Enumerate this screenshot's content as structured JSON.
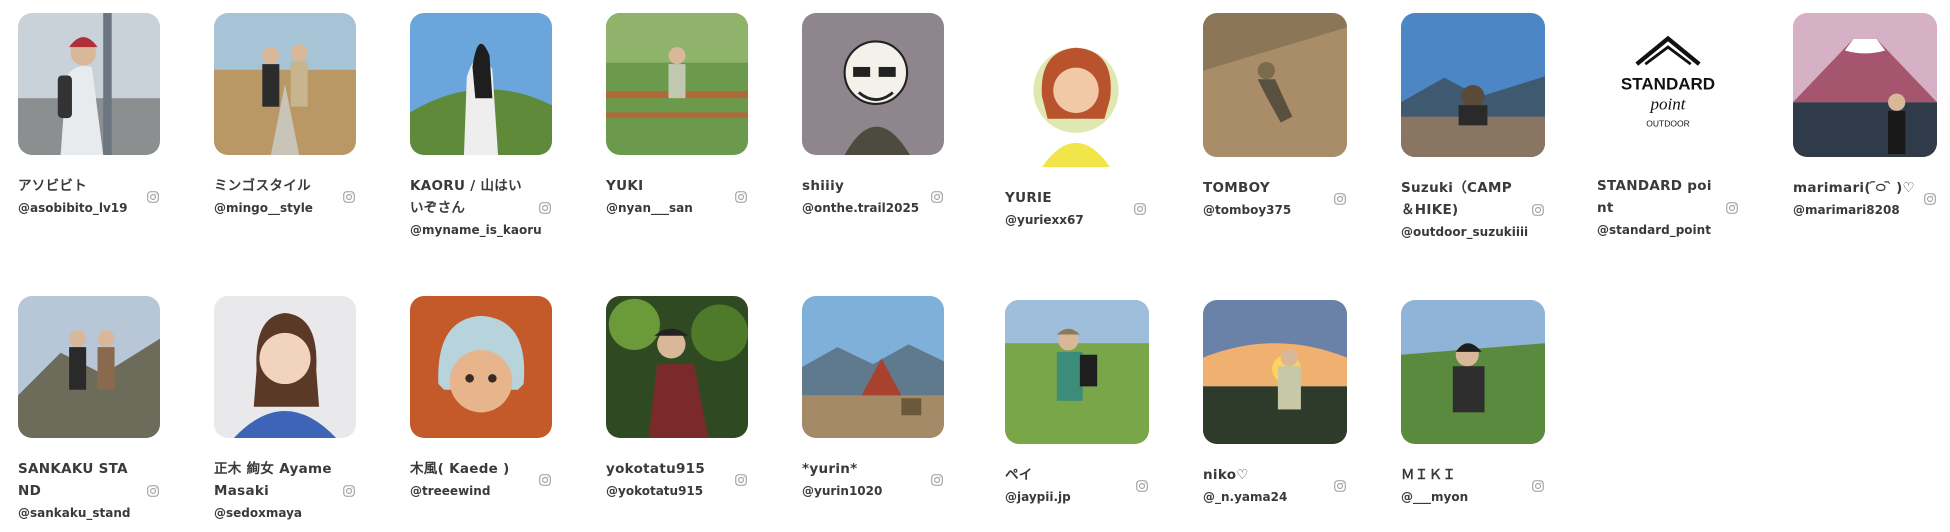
{
  "members": [
    {
      "name": "アソビビト",
      "handle": "@asobibito_lv19",
      "photo_icon": "person-with-red-beanie-photo"
    },
    {
      "name": "ミンゴスタイル",
      "handle": "@mingo__style",
      "photo_icon": "couple-on-boardwalk-photo"
    },
    {
      "name": "KAORU / 山はいいぞさん",
      "handle": "@myname_is_kaoru",
      "photo_icon": "hiker-on-grassy-hill-photo"
    },
    {
      "name": "YUKI",
      "handle": "@nyan___san",
      "photo_icon": "hiker-on-railing-photo"
    },
    {
      "name": "shiiiy",
      "handle": "@onthe.trail2025",
      "photo_icon": "sunglasses-man-illustration"
    },
    {
      "name": "YURIE",
      "handle": "@yuriexx67",
      "photo_icon": "woman-portrait-illustration"
    },
    {
      "name": "TOMBOY",
      "handle": "@tomboy375",
      "photo_icon": "hiker-on-rock-photo"
    },
    {
      "name": "Suzuki（CAMP＆HIKE)",
      "handle": "@outdoor_suzukiiii",
      "photo_icon": "man-viewing-mountains-photo"
    },
    {
      "name": "STANDARD point",
      "handle": "@standard_point",
      "photo_icon": "standard-point-logo"
    },
    {
      "name": "marimari( ᷇࿀ ᷆ )♡",
      "handle": "@marimari8208",
      "photo_icon": "mount-fuji-photo"
    },
    {
      "name": "SANKAKU STAND",
      "handle": "@sankaku_stand",
      "photo_icon": "couple-on-ridge-photo"
    },
    {
      "name": "正木 絢女 Ayame Masaki",
      "handle": "@sedoxmaya",
      "photo_icon": "woman-portrait-photo"
    },
    {
      "name": "木風( Kaede )",
      "handle": "@treeewind",
      "photo_icon": "blue-hair-portrait-photo"
    },
    {
      "name": "yokotatu915",
      "handle": "@yokotatu915",
      "photo_icon": "man-in-forest-photo"
    },
    {
      "name": "*yurin*",
      "handle": "@yurin1020",
      "photo_icon": "cabin-by-lake-photo"
    },
    {
      "name": "ペイ",
      "handle": "@jaypii.jp",
      "photo_icon": "hiker-with-backpack-photo"
    },
    {
      "name": "niko♡",
      "handle": "@_n.yama24",
      "photo_icon": "sunset-hiker-photo"
    },
    {
      "name": "ＭＩＫＩ",
      "handle": "@___myon",
      "photo_icon": "woman-on-hillside-photo"
    }
  ],
  "icons": {
    "social": "instagram-icon"
  },
  "colors": {
    "text": "#3a3a3a",
    "icon": "#9a9a9a",
    "background": "#ffffff"
  }
}
